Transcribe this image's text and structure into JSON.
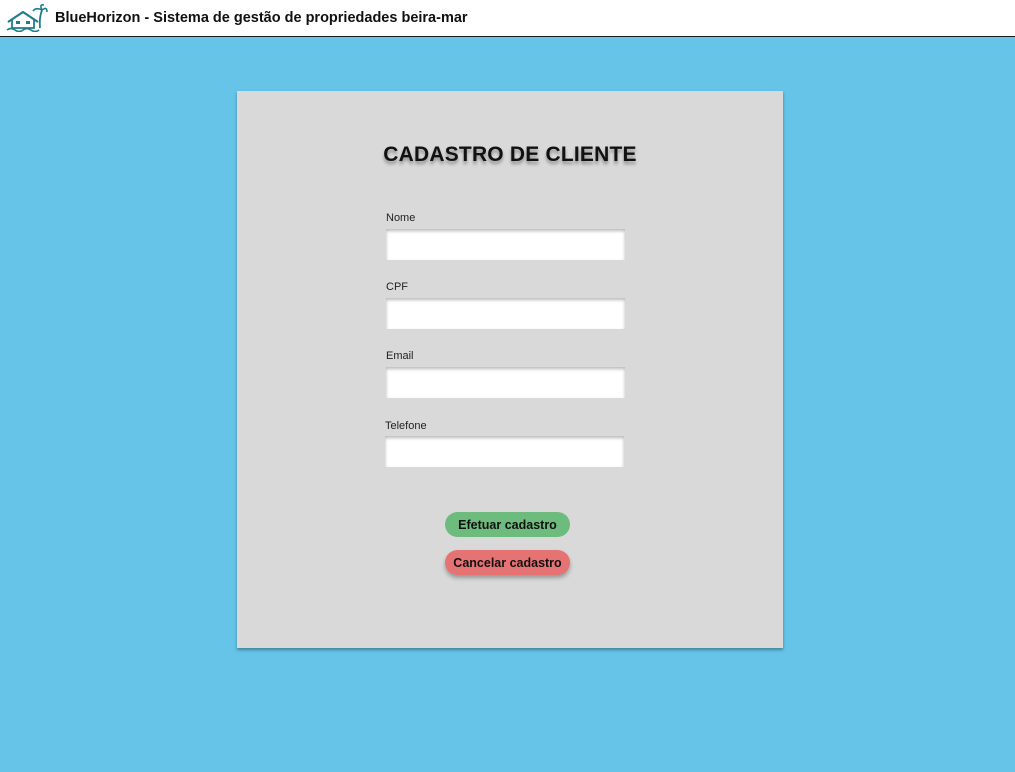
{
  "header": {
    "title": "BlueHorizon - Sistema de gestão de propriedades beira-mar",
    "logo_icon": "beach-house-logo-icon"
  },
  "form": {
    "title": "CADASTRO DE CLIENTE",
    "fields": [
      {
        "label": "Nome",
        "value": "",
        "placeholder": ""
      },
      {
        "label": "CPF",
        "value": "",
        "placeholder": ""
      },
      {
        "label": "Email",
        "value": "",
        "placeholder": ""
      },
      {
        "label": "Telefone",
        "value": "",
        "placeholder": ""
      }
    ],
    "submit_label": "Efetuar cadastro",
    "cancel_label": "Cancelar cadastro"
  },
  "colors": {
    "background": "#65c4e8",
    "card": "#d9d9d9",
    "submit_button": "#6dbb7d",
    "cancel_button": "#e57373",
    "logo": "#1e7d8c"
  }
}
